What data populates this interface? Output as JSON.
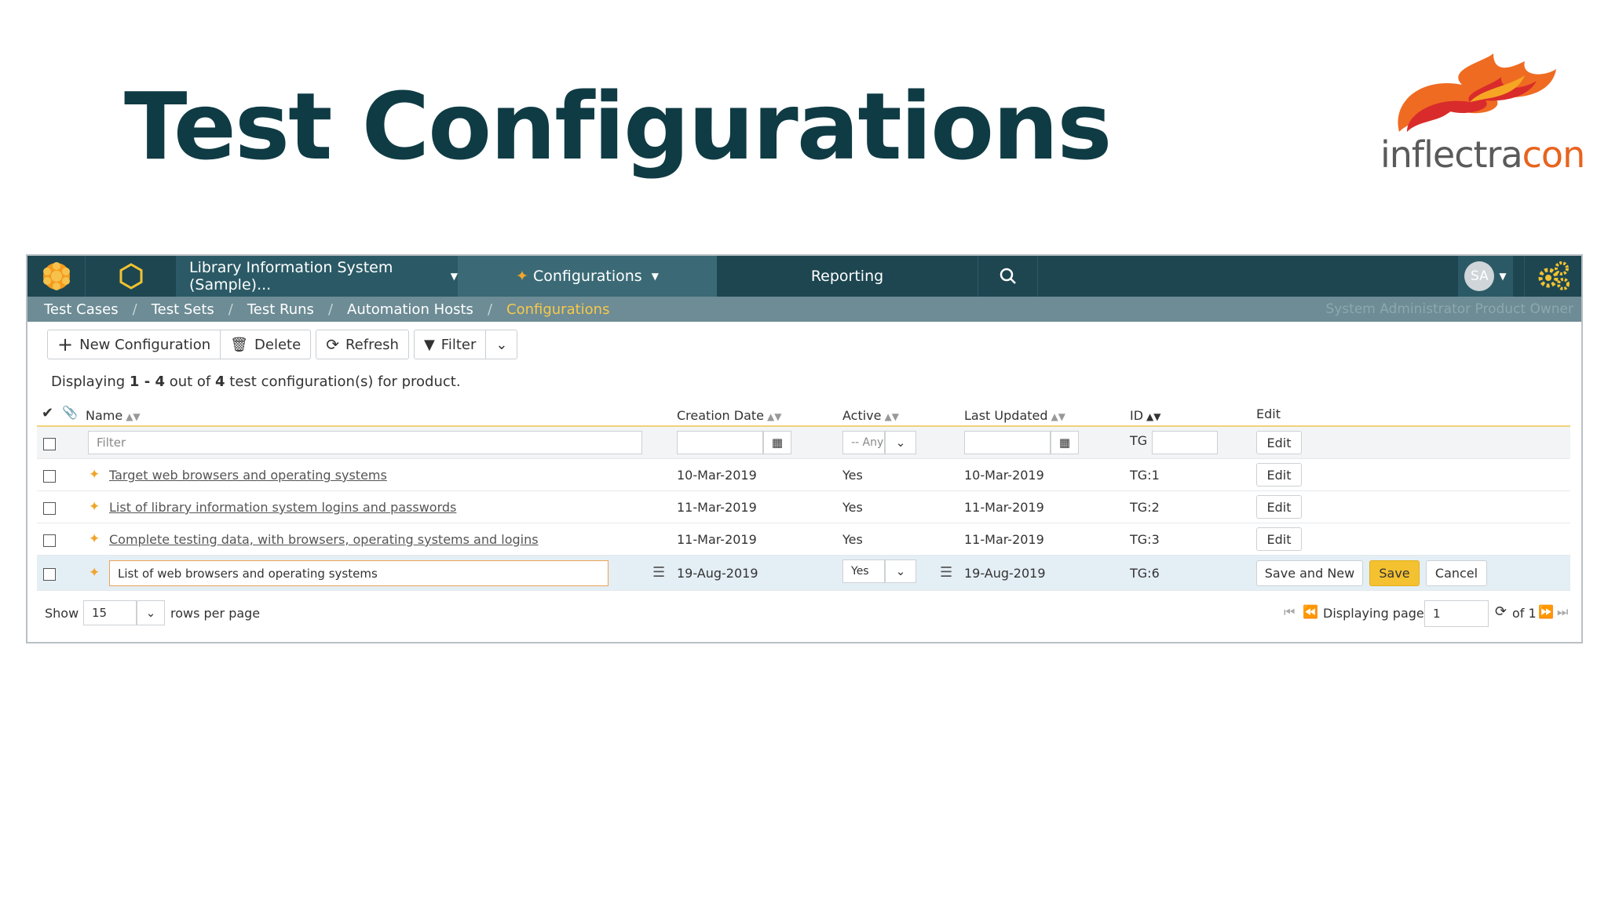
{
  "slide": {
    "title": "Test Configurations",
    "logo_part1": "inflectra",
    "logo_part2": "con"
  },
  "topbar": {
    "project": "Library Information System (Sample)...",
    "configurations": "Configurations",
    "reporting": "Reporting",
    "avatar_initials": "SA"
  },
  "breadcrumbs": {
    "items": [
      "Test Cases",
      "Test Sets",
      "Test Runs",
      "Automation Hosts",
      "Configurations"
    ],
    "separator": "/",
    "user_role": "System Administrator  Product Owner"
  },
  "toolbar": {
    "new_label": "New Configuration",
    "delete_label": "Delete",
    "refresh_label": "Refresh",
    "filter_label": "Filter"
  },
  "summary": {
    "prefix": "Displaying",
    "range": "1 - 4",
    "mid": "out of",
    "total": "4",
    "suffix": "test configuration(s) for product."
  },
  "table": {
    "headers": {
      "name": "Name",
      "creation_date": "Creation Date",
      "active": "Active",
      "last_updated": "Last Updated",
      "id": "ID",
      "edit": "Edit"
    },
    "filter": {
      "name_placeholder": "Filter",
      "active_value": "-- Any",
      "id_prefix": "TG",
      "edit_label": "Edit"
    },
    "rows": [
      {
        "name": "Target web browsers and operating systems",
        "created": "10-Mar-2019",
        "active": "Yes",
        "updated": "10-Mar-2019",
        "id": "TG:1",
        "action": "Edit"
      },
      {
        "name": "List of library information system logins and passwords",
        "created": "11-Mar-2019",
        "active": "Yes",
        "updated": "11-Mar-2019",
        "id": "TG:2",
        "action": "Edit"
      },
      {
        "name": "Complete testing data, with browsers, operating systems and logins",
        "created": "11-Mar-2019",
        "active": "Yes",
        "updated": "11-Mar-2019",
        "id": "TG:3",
        "action": "Edit"
      }
    ],
    "edit_row": {
      "name": "List of web browsers and operating systems",
      "created": "19-Aug-2019",
      "active": "Yes",
      "updated": "19-Aug-2019",
      "id": "TG:6",
      "save_new": "Save and New",
      "save": "Save",
      "cancel": "Cancel"
    }
  },
  "pager": {
    "show": "Show",
    "rows_value": "15",
    "rows_label": "rows per page",
    "displaying_page": "Displaying page",
    "page_value": "1",
    "of_label": "of 1"
  }
}
